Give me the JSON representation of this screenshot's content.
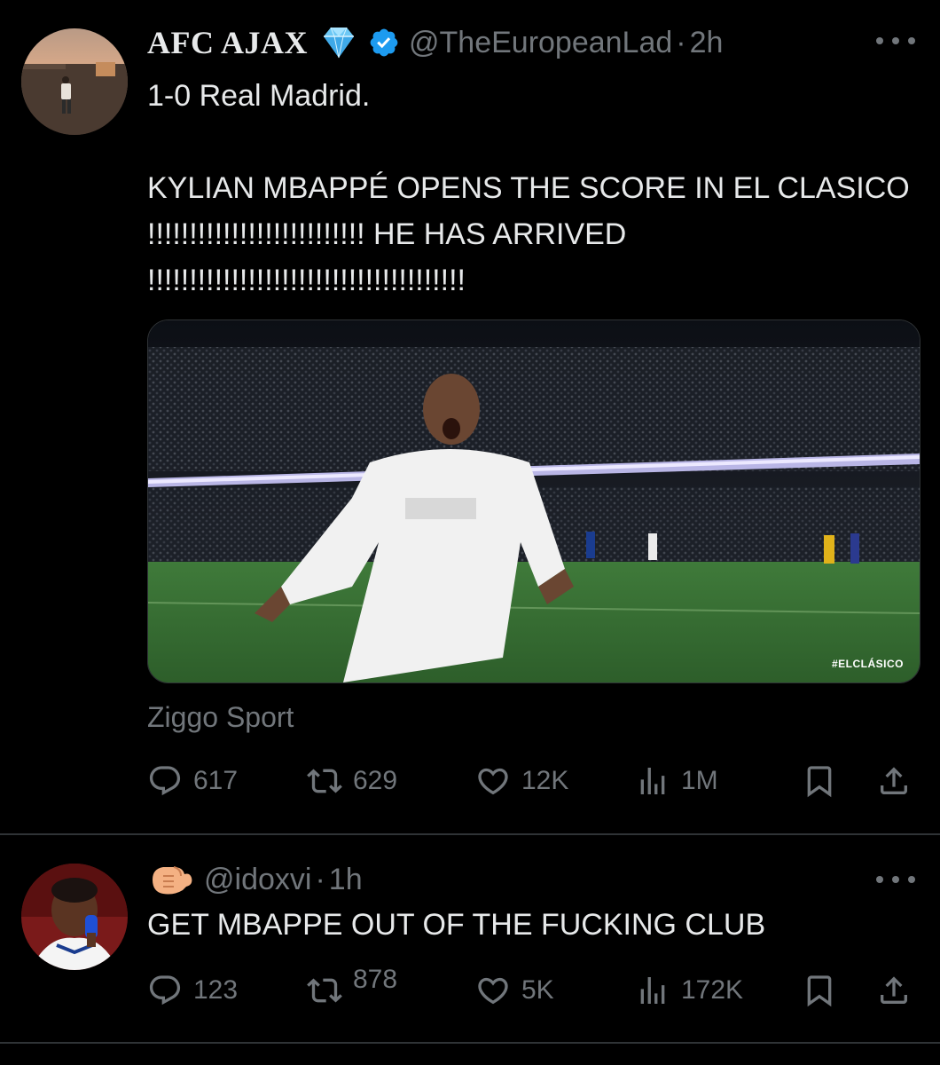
{
  "tweets": [
    {
      "author": "AFC AJAX",
      "handle": "@TheEuropeanLad",
      "separator": "·",
      "time": "2h",
      "text": "1-0 Real Madrid.\n\nKYLIAN MBAPPÉ OPENS THE SCORE IN EL CLASICO !!!!!!!!!!!!!!!!!!!!!!!!!! HE HAS ARRIVED !!!!!!!!!!!!!!!!!!!!!!!!!!!!!!!!!!!!!!",
      "media_tag": "#ELCLÁSICO",
      "attribution": "Ziggo Sport",
      "stats": {
        "replies": "617",
        "reposts": "629",
        "likes": "12K",
        "views": "1M"
      },
      "icons": {
        "badge": "diamond-icon",
        "verified": "verified-badge-icon"
      }
    },
    {
      "author_emoji": "flexed-biceps-icon",
      "handle": "@idoxvi",
      "separator": "·",
      "time": "1h",
      "text": "GET MBAPPE OUT OF THE FUCKING CLUB",
      "stats": {
        "replies": "123",
        "reposts": "878",
        "likes": "5K",
        "views": "172K"
      }
    }
  ],
  "colors": {
    "background": "#000000",
    "text": "#e7e9ea",
    "muted": "#71767b",
    "divider": "#2f3336",
    "verified": "#1d9bf0"
  }
}
